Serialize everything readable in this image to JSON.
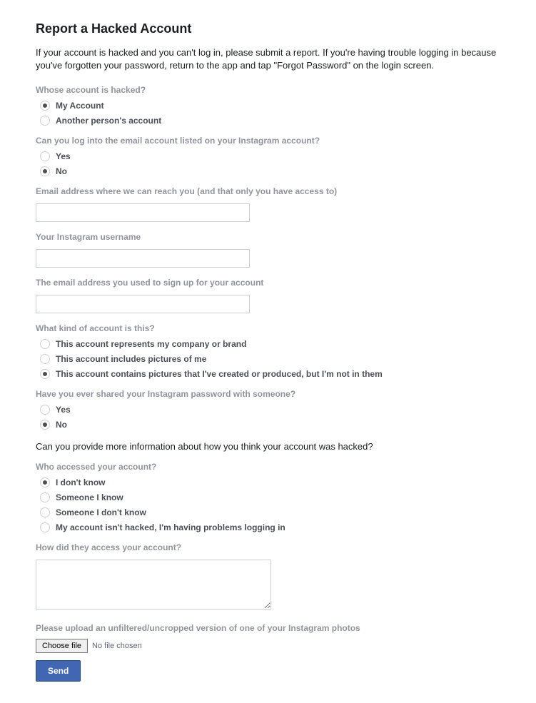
{
  "title": "Report a Hacked Account",
  "intro": "If your account is hacked and you can't log in, please submit a report. If you're having trouble logging in because you've forgotten your password, return to the app and tap \"Forgot Password\" on the login screen.",
  "q1": {
    "label": "Whose account is hacked?",
    "options": [
      "My Account",
      "Another person's account"
    ],
    "selected": 0
  },
  "q2": {
    "label": "Can you log into the email account listed on your Instagram account?",
    "options": [
      "Yes",
      "No"
    ],
    "selected": 1
  },
  "q3": {
    "label": "Email address where we can reach you (and that only you have access to)",
    "value": ""
  },
  "q4": {
    "label": "Your Instagram username",
    "value": ""
  },
  "q5": {
    "label": "The email address you used to sign up for your account",
    "value": ""
  },
  "q6": {
    "label": "What kind of account is this?",
    "options": [
      "This account represents my company or brand",
      "This account includes pictures of me",
      "This account contains pictures that I've created or produced, but I'm not in them"
    ],
    "selected": 2
  },
  "q7": {
    "label": "Have you ever shared your Instagram password with someone?",
    "options": [
      "Yes",
      "No"
    ],
    "selected": 1
  },
  "section2": "Can you provide more information about how you think your account was hacked?",
  "q8": {
    "label": "Who accessed your account?",
    "options": [
      "I don't know",
      "Someone I know",
      "Someone I don't know",
      "My account isn't hacked, I'm having problems logging in"
    ],
    "selected": 0
  },
  "q9": {
    "label": "How did they access your account?",
    "value": ""
  },
  "q10": {
    "label": "Please upload an unfiltered/uncropped version of one of your Instagram photos",
    "choose_label": "Choose file",
    "status": "No file chosen"
  },
  "send_label": "Send"
}
